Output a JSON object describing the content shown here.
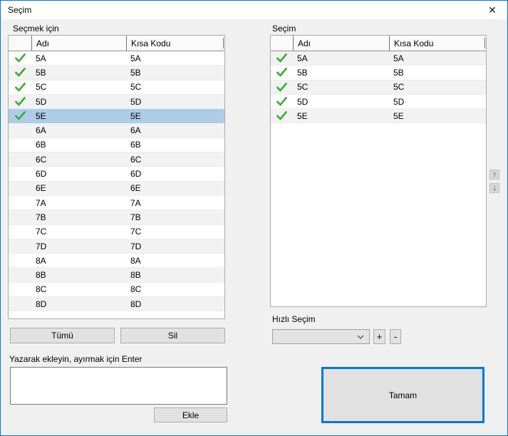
{
  "window": {
    "title": "Seçim"
  },
  "icons": {
    "close": "✕",
    "up_arrow": "↑",
    "down_arrow": "↓"
  },
  "colors": {
    "accent": "#0078d7",
    "check_green": "#3aaa39",
    "selected_row": "#aecbe8",
    "stripe": "#f2f2f2"
  },
  "left_panel": {
    "label": "Seçmek için",
    "table": {
      "columns": {
        "check": "",
        "name": "Adı",
        "code": "Kısa Kodu"
      },
      "rows": [
        {
          "name": "5A",
          "code": "5A",
          "checked": true,
          "selected": false
        },
        {
          "name": "5B",
          "code": "5B",
          "checked": true,
          "selected": false
        },
        {
          "name": "5C",
          "code": "5C",
          "checked": true,
          "selected": false
        },
        {
          "name": "5D",
          "code": "5D",
          "checked": true,
          "selected": false
        },
        {
          "name": "5E",
          "code": "5E",
          "checked": true,
          "selected": true
        },
        {
          "name": "6A",
          "code": "6A",
          "checked": false,
          "selected": false
        },
        {
          "name": "6B",
          "code": "6B",
          "checked": false,
          "selected": false
        },
        {
          "name": "6C",
          "code": "6C",
          "checked": false,
          "selected": false
        },
        {
          "name": "6D",
          "code": "6D",
          "checked": false,
          "selected": false
        },
        {
          "name": "6E",
          "code": "6E",
          "checked": false,
          "selected": false
        },
        {
          "name": "7A",
          "code": "7A",
          "checked": false,
          "selected": false
        },
        {
          "name": "7B",
          "code": "7B",
          "checked": false,
          "selected": false
        },
        {
          "name": "7C",
          "code": "7C",
          "checked": false,
          "selected": false
        },
        {
          "name": "7D",
          "code": "7D",
          "checked": false,
          "selected": false
        },
        {
          "name": "8A",
          "code": "8A",
          "checked": false,
          "selected": false
        },
        {
          "name": "8B",
          "code": "8B",
          "checked": false,
          "selected": false
        },
        {
          "name": "8C",
          "code": "8C",
          "checked": false,
          "selected": false
        },
        {
          "name": "8D",
          "code": "8D",
          "checked": false,
          "selected": false
        }
      ]
    },
    "all_button": "Tümü",
    "delete_button": "Sil",
    "type_add": {
      "label": "Yazarak ekleyin, ayırmak için Enter",
      "value": "",
      "add_button": "Ekle"
    }
  },
  "right_panel": {
    "label": "Seçim",
    "table": {
      "columns": {
        "check": "",
        "name": "Adı",
        "code": "Kısa Kodu"
      },
      "rows": [
        {
          "name": "5A",
          "code": "5A",
          "checked": true,
          "selected": false
        },
        {
          "name": "5B",
          "code": "5B",
          "checked": true,
          "selected": false
        },
        {
          "name": "5C",
          "code": "5C",
          "checked": true,
          "selected": false
        },
        {
          "name": "5D",
          "code": "5D",
          "checked": true,
          "selected": false
        },
        {
          "name": "5E",
          "code": "5E",
          "checked": true,
          "selected": false
        }
      ]
    },
    "quick_select": {
      "label": "Hızlı Seçim",
      "value": "",
      "add_label": "+",
      "remove_label": "-"
    },
    "ok_button": "Tamam"
  }
}
